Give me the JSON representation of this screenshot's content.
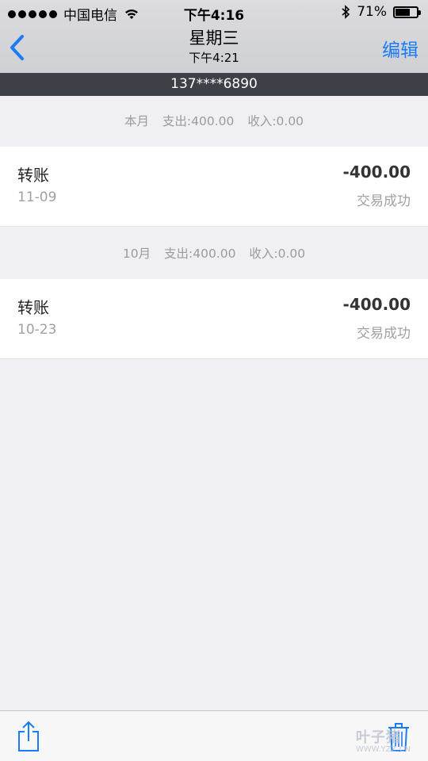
{
  "status_bar": {
    "carrier": "中国电信",
    "time": "下午4:16",
    "battery_text": "71%",
    "battery_level": 0.71,
    "icons": [
      "signal-dots-icon",
      "wifi-icon",
      "bluetooth-icon",
      "battery-icon"
    ]
  },
  "nav": {
    "title": "星期三",
    "subtitle": "下午4:21",
    "edit_label": "编辑",
    "back_icon": "chevron-left-icon"
  },
  "account": "137****6890",
  "sections": [
    {
      "month": "本月",
      "expense": "支出:400.00",
      "income": "收入:0.00",
      "items": [
        {
          "title": "转账",
          "date": "11-09",
          "amount": "-400.00",
          "status": "交易成功"
        }
      ]
    },
    {
      "month": "10月",
      "expense": "支出:400.00",
      "income": "收入:0.00",
      "items": [
        {
          "title": "转账",
          "date": "10-23",
          "amount": "-400.00",
          "status": "交易成功"
        }
      ]
    }
  ],
  "toolbar": {
    "share_icon": "share-icon",
    "trash_icon": "trash-icon"
  },
  "watermark": "叶子猪",
  "watermark_url": "WWW.YZZ.CN",
  "colors": {
    "accent": "#1a7cf5",
    "phone_bar": "#3d4047",
    "background": "#efeff4"
  }
}
